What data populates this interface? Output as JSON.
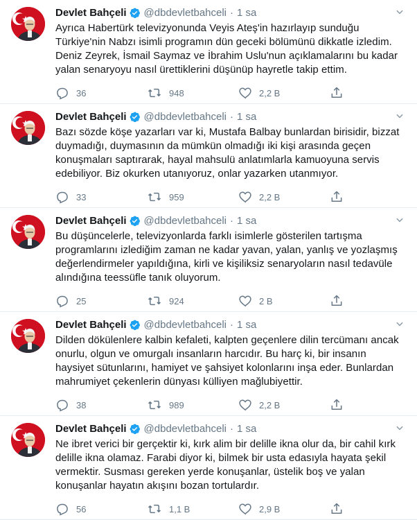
{
  "author": {
    "name": "Devlet Bahçeli",
    "handle": "@dbdevletbahceli",
    "time": "1 sa"
  },
  "colors": {
    "verified": "#1da1f2",
    "secondary": "#657786",
    "divider": "#e6ecf0"
  },
  "tweets": [
    {
      "text": "Ayrıca Habertürk televizyonunda Veyis Ateş'in hazırlayıp sunduğu\nTürkiye'nin Nabzı isimli programın dün geceki bölümünü dikkatle izledim.\nDeniz Zeyrek, İsmail Saymaz ve İbrahim Uslu'nun açıklamalarını bu kadar\nyalan senaryoyu nasıl ürettiklerini düşünüp hayretle takip ettim.",
      "replies": "36",
      "retweets": "948",
      "likes": "2,2 B"
    },
    {
      "text": "Bazı sözde köşe yazarları var ki, Mustafa Balbay bunlardan birisidir, bizzat\nduymadığı, duymasının da mümkün olmadığı iki kişi arasında geçen\nkonuşmaları saptırarak, hayal mahsulü anlatımlarla kamuoyuna servis\nedebiliyor. Biz okurken utanıyoruz, onlar yazarken utanmıyor.",
      "replies": "33",
      "retweets": "959",
      "likes": "2,2 B"
    },
    {
      "text": "Bu düşüncelerle, televizyonlarda farklı isimlerle gösterilen tartışma\nprogramlarını izlediğim zaman ne kadar yavan, yalan, yanlış ve yozlaşmış\ndeğerlendirmeler yapıldığına, kirli ve kişiliksiz senaryoların nasıl tedavüle\nalındığına teessüfle tanık oluyorum.",
      "replies": "25",
      "retweets": "924",
      "likes": "2 B"
    },
    {
      "text": "Dilden dökülenlere kalbin kefaleti, kalpten geçenlere dilin tercümanı ancak\nonurlu, olgun ve omurgalı insanların harcıdır. Bu harç ki, bir insanın\nhaysiyet sütunlarını, hamiyet ve şahsiyet kolonlarını inşa eder. Bunlardan\nmahrumiyet çekenlerin dünyası külliyen mağlubiyettir.",
      "replies": "38",
      "retweets": "989",
      "likes": "2,2 B"
    },
    {
      "text": "Ne ibret verici bir gerçektir ki, kırk alim bir delille ikna olur da, bir cahil kırk\ndelille ikna olamaz. Farabi diyor ki, bilmek bir usta edasıyla hayata şekil\nvermektir. Susması gereken yerde konuşanlar, üstelik boş ve yalan\nkonuşanlar hayatın akışını bozan tortulardır.",
      "replies": "56",
      "retweets": "1,1 B",
      "likes": "2,9 B"
    }
  ]
}
